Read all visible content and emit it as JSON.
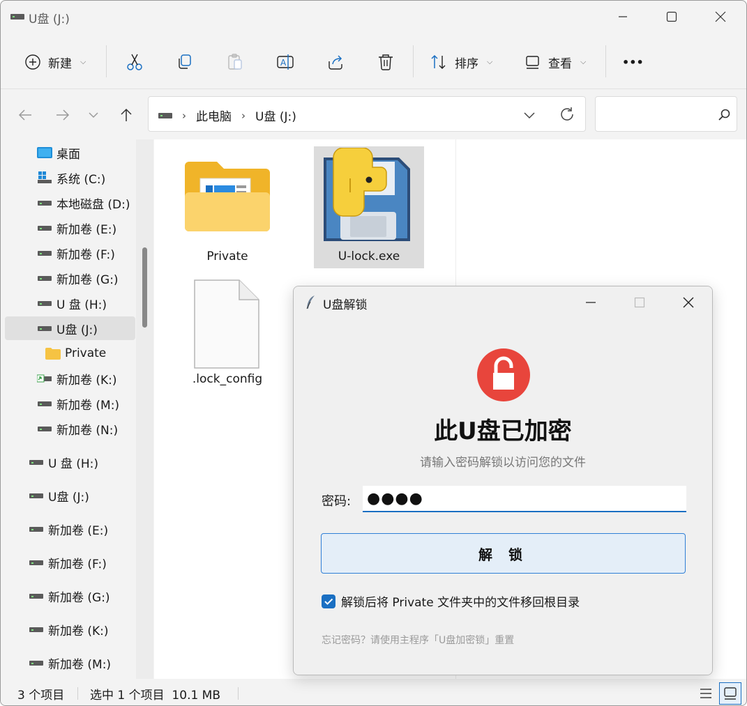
{
  "window": {
    "title": "U盘 (J:)",
    "minimize_icon": "minimize-icon",
    "maximize_icon": "maximize-icon",
    "close_icon": "close-icon"
  },
  "toolbar": {
    "new_label": "新建",
    "sort_label": "排序",
    "view_label": "查看",
    "more_label": "•••"
  },
  "address": {
    "crumbs": [
      "此电脑",
      "U盘 (J:)"
    ],
    "search_placeholder": ""
  },
  "sidebar": {
    "items": [
      {
        "label": "桌面",
        "icon": "desktop-icon"
      },
      {
        "label": "系统 (C:)",
        "icon": "windows-drive-icon"
      },
      {
        "label": "本地磁盘 (D:)",
        "icon": "drive-icon"
      },
      {
        "label": "新加卷 (E:)",
        "icon": "drive-icon"
      },
      {
        "label": "新加卷 (F:)",
        "icon": "drive-icon"
      },
      {
        "label": "新加卷 (G:)",
        "icon": "drive-icon"
      },
      {
        "label": "U 盘 (H:)",
        "icon": "drive-icon"
      },
      {
        "label": "U盘 (J:)",
        "icon": "drive-icon",
        "selected": true
      },
      {
        "label": "Private",
        "icon": "folder-icon"
      },
      {
        "label": "新加卷 (K:)",
        "icon": "shared-drive-icon"
      },
      {
        "label": "新加卷 (M:)",
        "icon": "drive-icon"
      },
      {
        "label": "新加卷 (N:)",
        "icon": "drive-icon"
      },
      {
        "label": "U 盘 (H:)",
        "icon": "drive-icon"
      },
      {
        "label": "U盘 (J:)",
        "icon": "drive-icon"
      },
      {
        "label": "新加卷 (E:)",
        "icon": "drive-icon"
      },
      {
        "label": "新加卷 (F:)",
        "icon": "drive-icon"
      },
      {
        "label": "新加卷 (G:)",
        "icon": "drive-icon"
      },
      {
        "label": "新加卷 (K:)",
        "icon": "drive-icon"
      },
      {
        "label": "新加卷 (M:)",
        "icon": "drive-icon"
      }
    ]
  },
  "files": [
    {
      "name": "Private",
      "icon": "folder-icon"
    },
    {
      "name": "U-lock.exe",
      "icon": "python-floppy-icon",
      "selected": true
    },
    {
      "name": ".lock_config",
      "icon": "blank-file-icon"
    }
  ],
  "status": {
    "count": "3 个项目",
    "selection": "选中 1 个项目  10.1 MB"
  },
  "dialog": {
    "title": "U盘解锁",
    "heading": "此U盘已加密",
    "subheading": "请输入密码解锁以访问您的文件",
    "password_label": "密码:",
    "password_value": "●●●●",
    "unlock_button": "解 锁",
    "checkbox_label": "解锁后将 Private 文件夹中的文件移回根目录",
    "checkbox_checked": true,
    "hint": "忘记密码？请使用主程序「U盘加密锁」重置",
    "accent_color": "#1a6fc2",
    "lock_color": "#e8453c"
  }
}
